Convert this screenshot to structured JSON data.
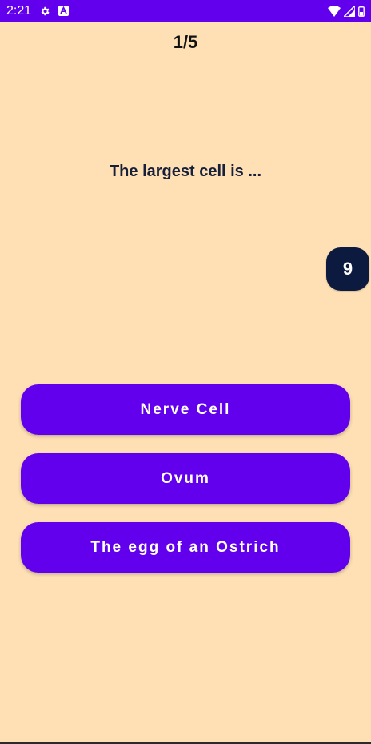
{
  "status_bar": {
    "time": "2:21",
    "left_icons": [
      "gear-icon",
      "a-badge-icon"
    ],
    "right_icons": [
      "wifi-icon",
      "signal-icon",
      "battery-icon"
    ]
  },
  "quiz": {
    "progress": "1/5",
    "question": "The largest cell is ...",
    "timer": "9",
    "answers": [
      "Nerve Cell",
      "Ovum",
      "The egg of an Ostrich"
    ]
  },
  "colors": {
    "background": "#FFE0B5",
    "accent": "#6200EE",
    "timer_bg": "#0B1A3E",
    "question_text": "#17203A"
  }
}
